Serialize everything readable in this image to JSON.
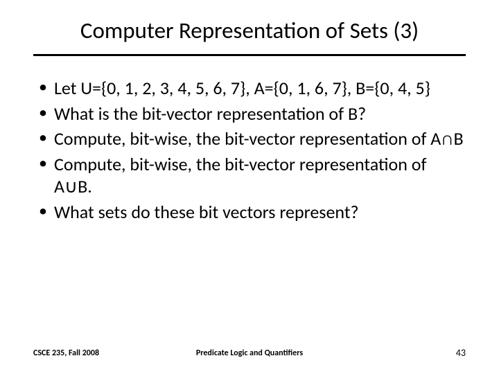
{
  "slide": {
    "title": "Computer Representation of Sets (3)",
    "bullets": [
      "Let U={0, 1, 2, 3, 4, 5, 6, 7}, A={0, 1, 6, 7}, B={0, 4, 5}",
      "What is the bit-vector representation of B?",
      "Compute, bit-wise, the bit-vector representation of A∩B",
      "Compute, bit-wise, the bit-vector representation of A∪B.",
      "What sets do these bit vectors represent?"
    ]
  },
  "footer": {
    "left": "CSCE 235, Fall 2008",
    "center": "Predicate Logic and Quantifiers",
    "page": "43"
  }
}
